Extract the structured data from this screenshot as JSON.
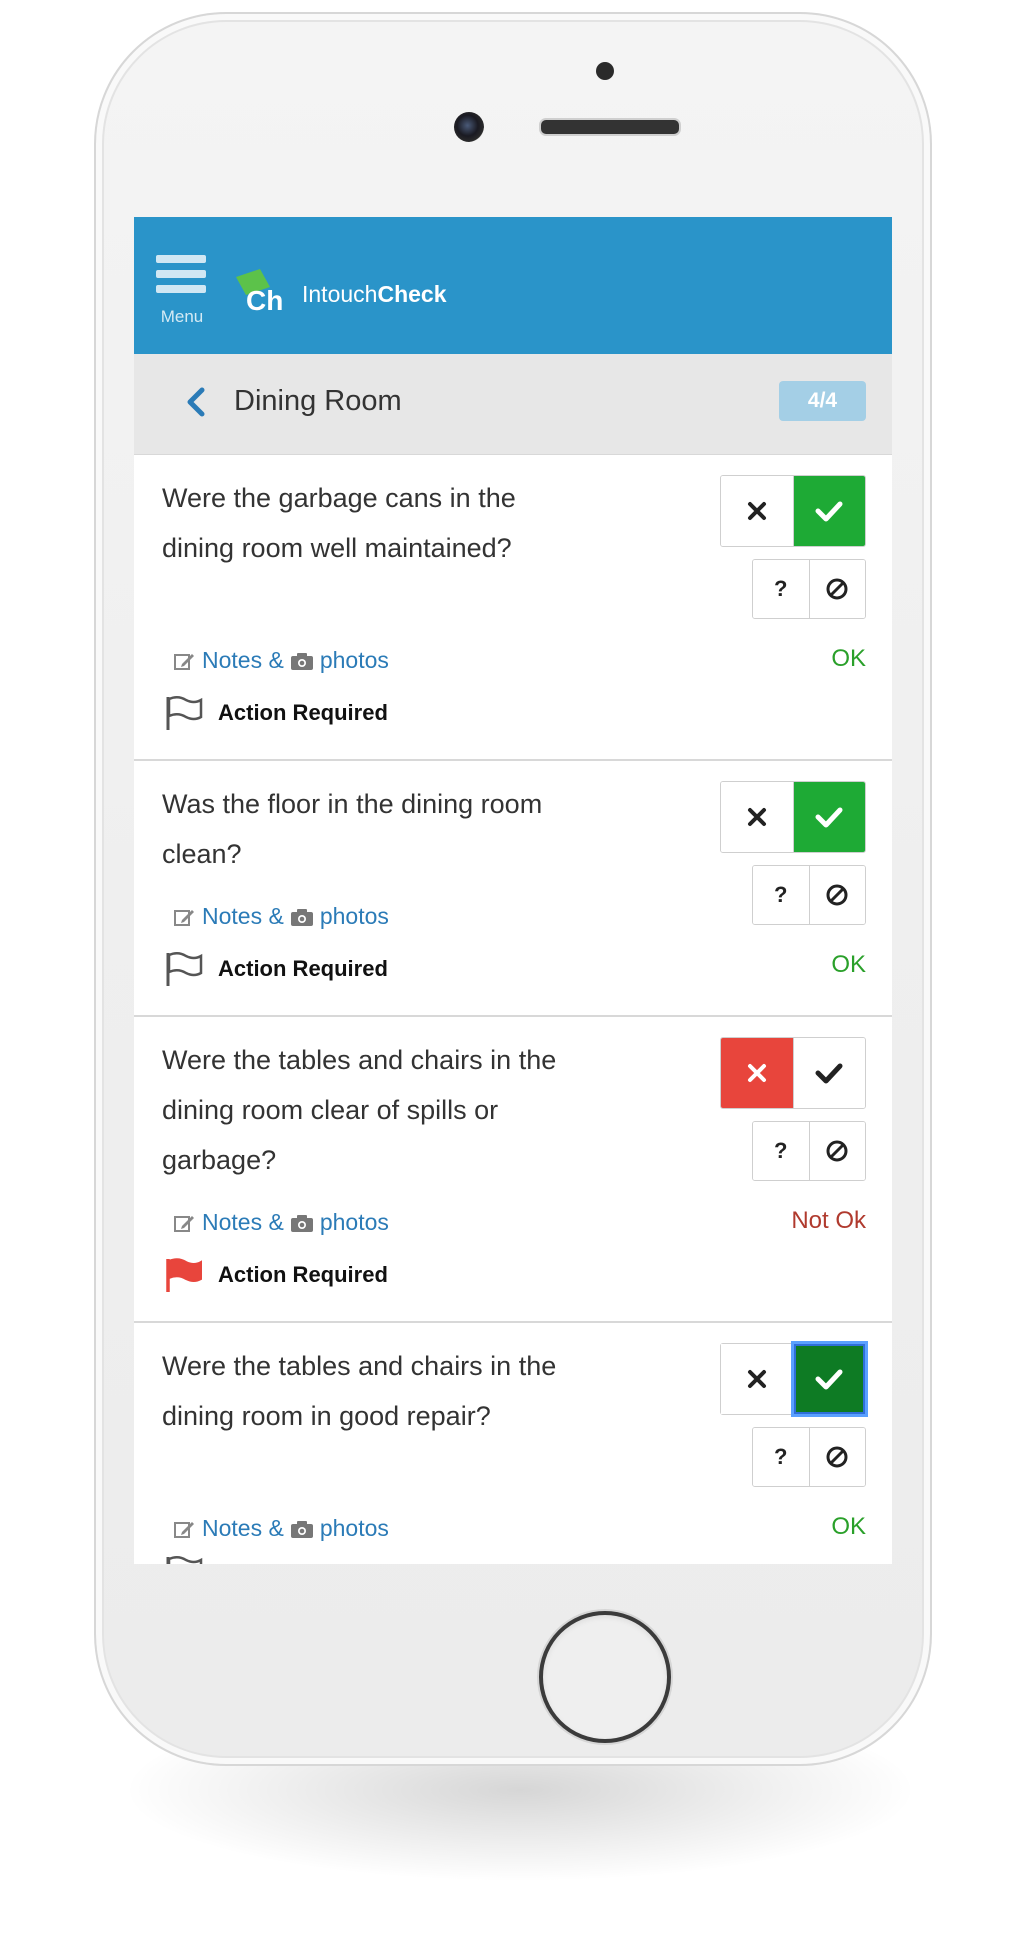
{
  "app": {
    "menu_label": "Menu",
    "brand_regular": "Intouch",
    "brand_bold": "Check",
    "logo_text": "Ch"
  },
  "section": {
    "title": "Dining Room",
    "progress": "4/4"
  },
  "labels": {
    "notes": "Notes &",
    "photos": "photos",
    "action_required": "Action Required",
    "question_mark": "?"
  },
  "items": [
    {
      "question": "Were the garbage cans in the dining room well maintained?",
      "answer": "yes",
      "status": "OK",
      "flagged": false
    },
    {
      "question": "Was the floor in the dining room clean?",
      "answer": "yes",
      "status": "OK",
      "flagged": false
    },
    {
      "question": "Were the tables and chairs in the dining room clear of spills or garbage?",
      "answer": "no",
      "status": "Not Ok",
      "flagged": true
    },
    {
      "question": "Were the tables and chairs in the dining room in good repair?",
      "answer": "yes",
      "status": "OK",
      "flagged": false,
      "focused": true
    }
  ],
  "colors": {
    "header_blue": "#2a94c9",
    "yes_green": "#1eaa35",
    "focused_green": "#0e7b24",
    "no_red": "#e8453c",
    "link_blue": "#2b7bb7",
    "ok_text": "#2aa02a",
    "notok_text": "#b03a2e",
    "flag_red": "#e8453c"
  },
  "icons": {
    "no": "x-icon",
    "yes": "check-icon",
    "na": "ban-icon",
    "unknown": "question-icon",
    "notes": "edit-icon",
    "photos": "camera-icon",
    "flag": "flag-icon",
    "back": "chevron-left-icon"
  }
}
